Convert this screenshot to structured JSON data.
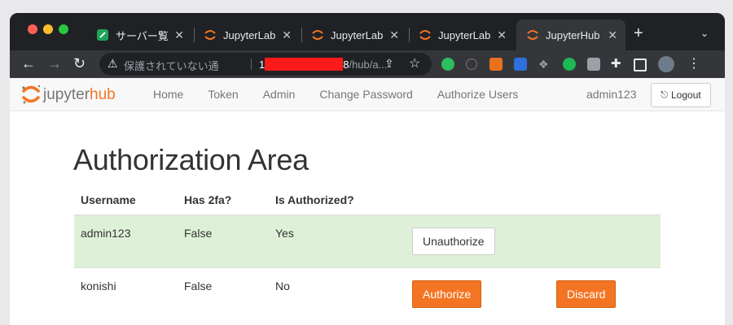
{
  "browser": {
    "tabs": [
      {
        "title": "サーバー覧"
      },
      {
        "title": "JupyterLab"
      },
      {
        "title": "JupyterLab"
      },
      {
        "title": "JupyterLab"
      },
      {
        "title": "JupyterHub"
      }
    ],
    "address": {
      "insecure_label": "保護されていない通",
      "host_prefix": "1",
      "host_suffix": "8",
      "path": "/hub/a..."
    }
  },
  "navbar": {
    "links": [
      "Home",
      "Token",
      "Admin",
      "Change Password",
      "Authorize Users"
    ],
    "user": "admin123",
    "logout_label": "Logout"
  },
  "page_title": "Authorization Area",
  "table": {
    "headers": [
      "Username",
      "Has 2fa?",
      "Is Authorized?"
    ],
    "rows": [
      {
        "username": "admin123",
        "has_2fa": "False",
        "authorized": "Yes",
        "action": "Unauthorize"
      },
      {
        "username": "konishi",
        "has_2fa": "False",
        "authorized": "No",
        "action": "Authorize",
        "discard": "Discard"
      }
    ]
  },
  "colors": {
    "jupyter_orange": "#f37524",
    "authorized_row": "#dff0d8"
  }
}
